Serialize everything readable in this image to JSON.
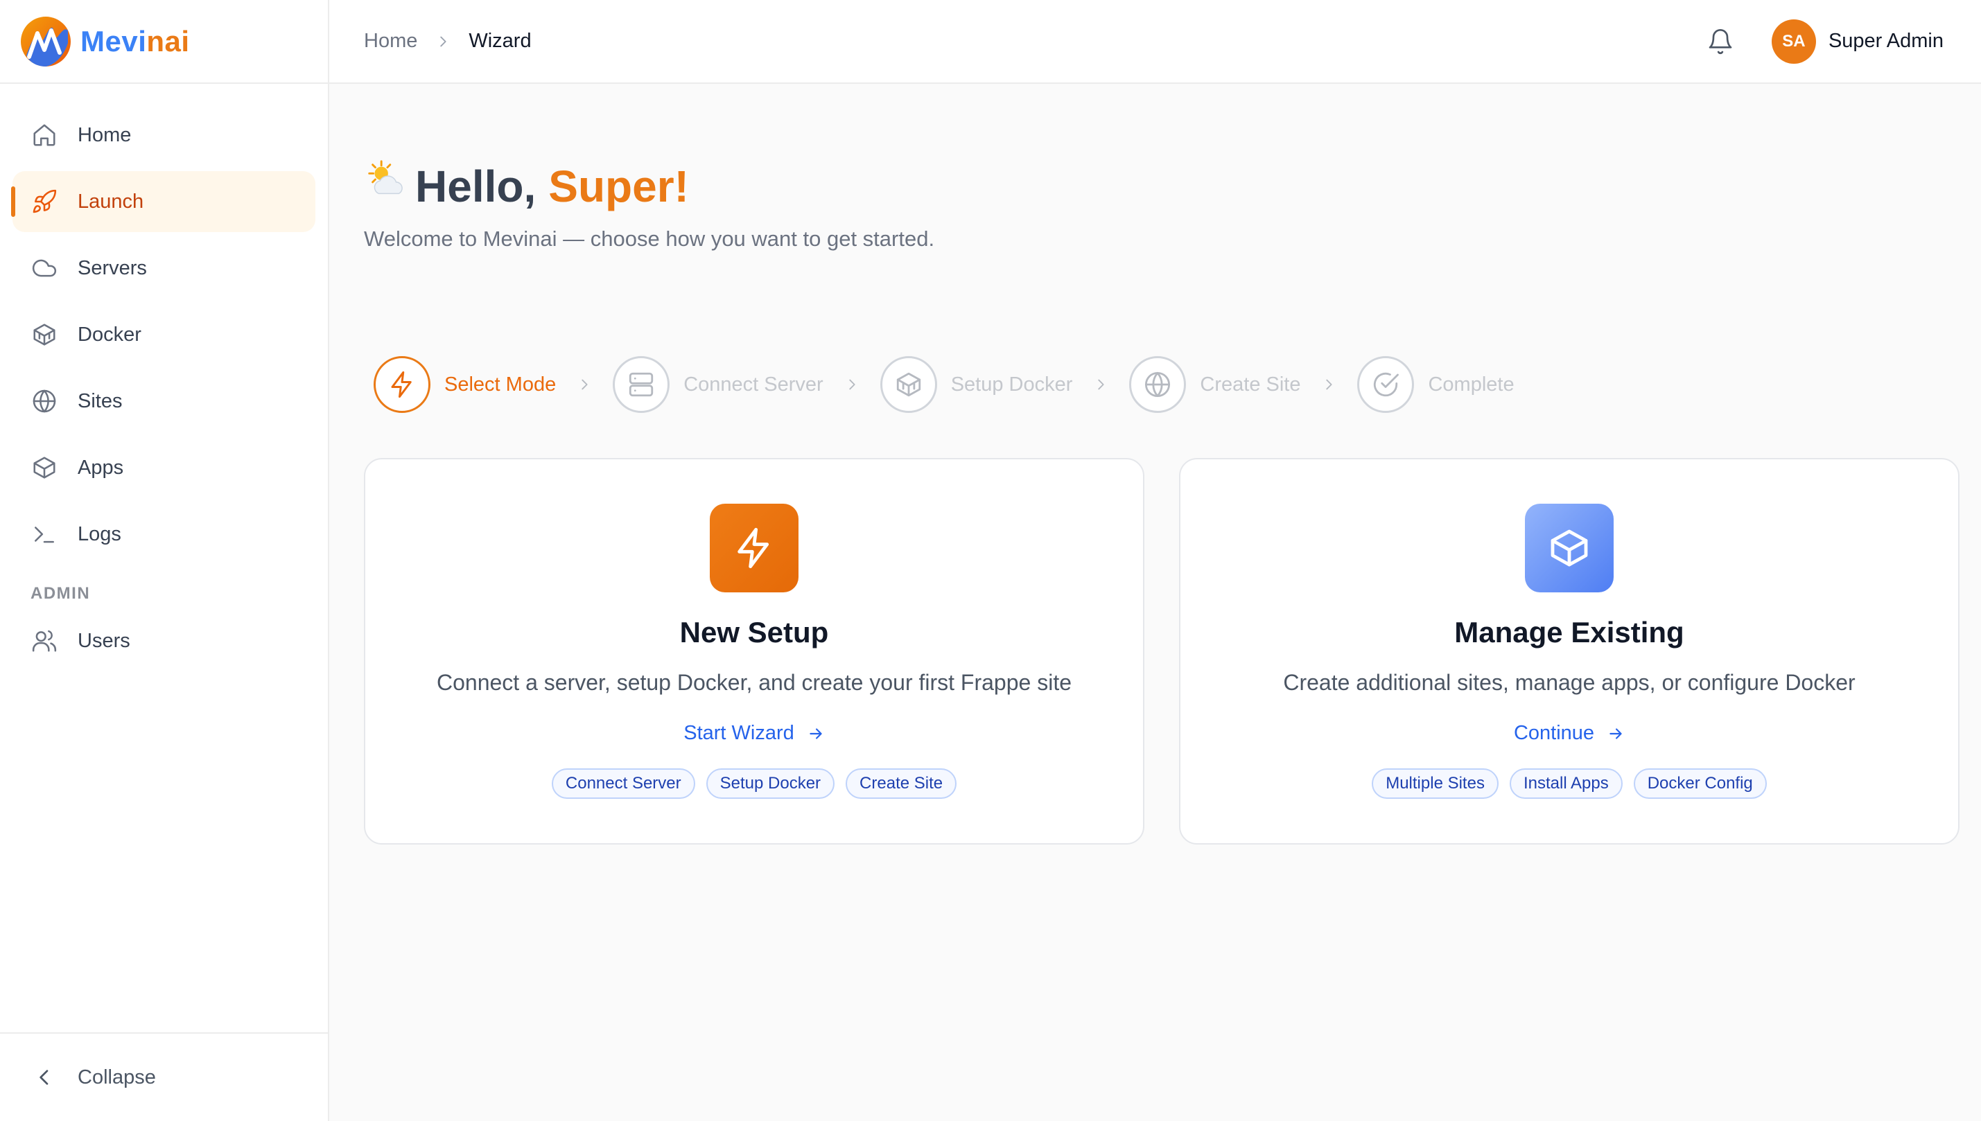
{
  "brand": {
    "name_part1": "Mevi",
    "name_part2": "nai",
    "accent_color": "#ea7a16",
    "primary_color": "#3b82f6"
  },
  "sidebar": {
    "items": [
      {
        "label": "Home",
        "icon": "home-icon"
      },
      {
        "label": "Launch",
        "icon": "rocket-icon",
        "active": true
      },
      {
        "label": "Servers",
        "icon": "cloud-icon"
      },
      {
        "label": "Docker",
        "icon": "docker-box-icon"
      },
      {
        "label": "Sites",
        "icon": "globe-icon"
      },
      {
        "label": "Apps",
        "icon": "package-icon"
      },
      {
        "label": "Logs",
        "icon": "terminal-icon"
      }
    ],
    "admin_section": "ADMIN",
    "admin_items": [
      {
        "label": "Users",
        "icon": "users-icon"
      }
    ],
    "collapse_label": "Collapse"
  },
  "header": {
    "breadcrumb": [
      "Home",
      "Wizard"
    ],
    "user_initials": "SA",
    "user_name": "Super Admin"
  },
  "main": {
    "greeting_prefix": "Hello,",
    "greeting_name": "Super!",
    "subtitle": "Welcome to Mevinai — choose how you want to get started.",
    "steps": [
      {
        "label": "Select Mode",
        "icon": "lightning-icon",
        "active": true
      },
      {
        "label": "Connect Server",
        "icon": "server-icon"
      },
      {
        "label": "Setup Docker",
        "icon": "docker-box-icon"
      },
      {
        "label": "Create Site",
        "icon": "globe-icon"
      },
      {
        "label": "Complete",
        "icon": "check-circle-icon"
      }
    ],
    "cards": [
      {
        "title": "New Setup",
        "description": "Connect a server, setup Docker, and create your first Frappe site",
        "link": "Start Wizard",
        "icon": "lightning-icon",
        "chips": [
          "Connect Server",
          "Setup Docker",
          "Create Site"
        ]
      },
      {
        "title": "Manage Existing",
        "description": "Create additional sites, manage apps, or configure Docker",
        "link": "Continue",
        "icon": "cube-icon",
        "chips": [
          "Multiple Sites",
          "Install Apps",
          "Docker Config"
        ]
      }
    ]
  }
}
